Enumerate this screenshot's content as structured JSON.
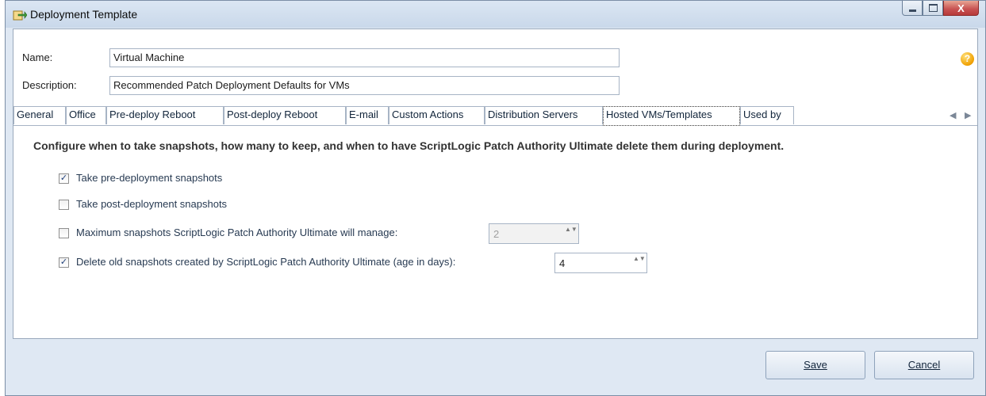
{
  "window": {
    "title": "Deployment Template",
    "close_glyph": "X"
  },
  "form": {
    "name_label": "Name:",
    "name_value": "Virtual Machine",
    "description_label": "Description:",
    "description_value": "Recommended Patch Deployment Defaults for VMs",
    "help_glyph": "?"
  },
  "tabs": [
    {
      "label": "General"
    },
    {
      "label": "Office"
    },
    {
      "label": "Pre-deploy Reboot"
    },
    {
      "label": "Post-deploy Reboot"
    },
    {
      "label": "E-mail"
    },
    {
      "label": "Custom Actions"
    },
    {
      "label": "Distribution Servers"
    },
    {
      "label": "Hosted VMs/Templates"
    },
    {
      "label": "Used by"
    }
  ],
  "active_tab": "Hosted VMs/Templates",
  "tab_scroll": {
    "left": "◀",
    "right": "▶"
  },
  "content": {
    "heading": "Configure when to take snapshots, how many to keep, and when to have ScriptLogic Patch Authority Ultimate delete them during deployment.",
    "options": [
      {
        "label": "Take pre-deployment snapshots",
        "checked": true,
        "check_glyph": "✓"
      },
      {
        "label": "Take post-deployment snapshots",
        "checked": false,
        "check_glyph": ""
      },
      {
        "label": "Maximum snapshots ScriptLogic Patch Authority Ultimate will manage:",
        "checked": false,
        "check_glyph": "",
        "value": "2",
        "enabled": false
      },
      {
        "label": "Delete old snapshots created by ScriptLogic Patch Authority Ultimate (age in days):",
        "checked": true,
        "check_glyph": "✓",
        "value": "4",
        "enabled": true
      }
    ],
    "spin_arrows": "▲▼"
  },
  "buttons": {
    "save": "Save",
    "cancel": "Cancel"
  },
  "colors": {
    "titlebar": "#c9d8ea",
    "close": "#c75050",
    "help": "#f0a000"
  }
}
